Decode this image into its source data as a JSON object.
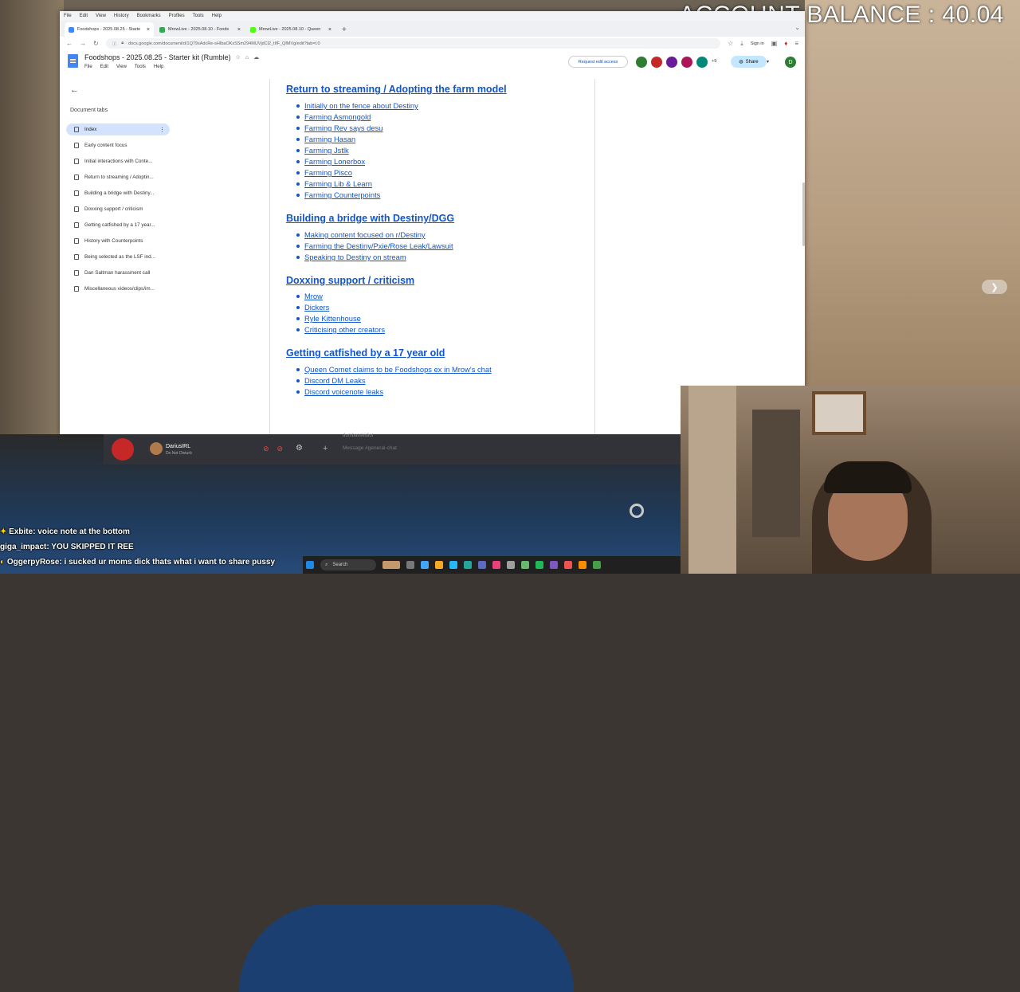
{
  "overlay": {
    "balance": "ACCOUNT BALANCE : 40.04"
  },
  "browser": {
    "menu": [
      "File",
      "Edit",
      "View",
      "History",
      "Bookmarks",
      "Profiles",
      "Tools",
      "Help"
    ],
    "tabs": [
      {
        "title": "Foodshops - 2025.08.25 - Starte",
        "active": true,
        "color": "#4285f4"
      },
      {
        "title": "MrowLive - 2025.08.10 - Foods",
        "active": false,
        "color": "#34a853"
      },
      {
        "title": "MrowLive - 2025.08.10 - Queen",
        "active": false,
        "color": "#53fc18"
      }
    ],
    "url": "docs.google.com/document/d/1Q79sAdcRe-sHIbaOKsSSm294MUVjdCl2_tIfF_QfMVg/edit?tab=t.0",
    "signin": "Sign in"
  },
  "doc": {
    "title": "Foodshops - 2025.08.25 - Starter kit (Rumble)",
    "menu": [
      "File",
      "Edit",
      "View",
      "Tools",
      "Help"
    ],
    "request_access": "Request edit access",
    "plus_count": "+9",
    "share": "Share",
    "user_initial": "D",
    "avatar_colors": [
      "#2e7d32",
      "#c62828",
      "#6a1b9a",
      "#ad1457",
      "#00897b"
    ]
  },
  "sidebar": {
    "heading": "Document tabs",
    "items": [
      "Index",
      "Early content focus",
      "Initial interactions with Conte...",
      "Return to streaming / Adoptin...",
      "Building a bridge with Destiny...",
      "Doxxing support / criticism",
      "Getting catfished by a 17 year...",
      "History with Counterpoints",
      "Being selected as the LSF ind...",
      "Dan Saltman harassment call",
      "Miscellaneous videos/clips/im..."
    ]
  },
  "content": {
    "sections": [
      {
        "heading": "Return to streaming / Adopting the farm model",
        "items": [
          "Initially on the fence about Destiny",
          "Farming Asmongold",
          "Farming Rev says desu",
          "Farming Hasan",
          "Farming Jstlk",
          "Farming Lonerbox",
          "Farming Pisco",
          "Farming Lib & Learn",
          "Farming Counterpoints"
        ]
      },
      {
        "heading": "Building a bridge with Destiny/DGG",
        "items": [
          "Making content focused on r/Destiny",
          "Farming the Destiny/Pxie/Rose Leak/Lawsuit",
          "Speaking to Destiny on stream"
        ]
      },
      {
        "heading": "Doxxing support / criticism",
        "items": [
          "Mrow",
          "Dickers",
          "Ryle Kittenhouse",
          "Criticising other creators"
        ]
      },
      {
        "heading": "Getting catfished by a 17 year old",
        "items": [
          "Queen Comet claims to be Foodshops ex in Mrow's chat",
          "Discord DM Leaks",
          "Discord voicenote leaks"
        ]
      }
    ]
  },
  "discord": {
    "username": "DariusIRL",
    "status": "Do Not Disturb",
    "message_placeholder": "Message #general-chat",
    "top_author": "dumbasskidiot"
  },
  "chat": [
    {
      "user": "Exbite",
      "text": ": voice note at the bottom"
    },
    {
      "user": "giga_impact",
      "text": ": YOU SKIPPED IT REE"
    },
    {
      "user": "OggerpyRose",
      "text": ": i sucked ur moms dick thats what i want to share pussy"
    }
  ],
  "taskbar": {
    "search": "Search"
  }
}
